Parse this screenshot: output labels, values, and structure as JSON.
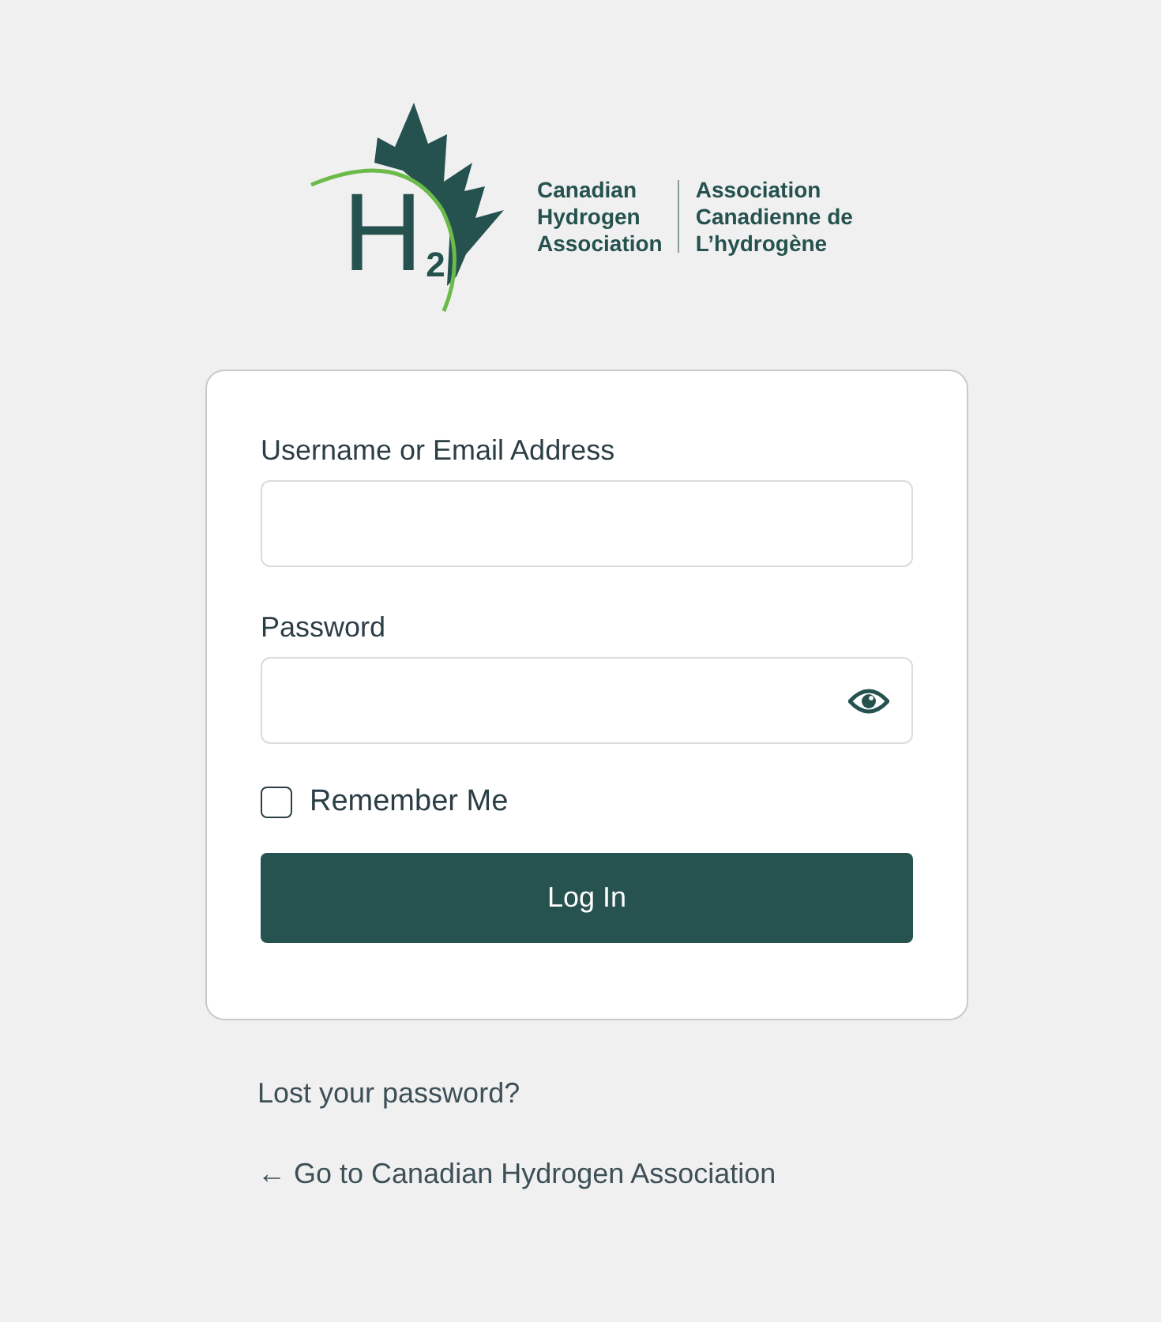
{
  "logo": {
    "mark": "H",
    "mark_sub": "2",
    "name_en": [
      "Canadian",
      "Hydrogen",
      "Association"
    ],
    "name_fr": [
      "Association",
      "Canadienne de",
      "L’hydrogène"
    ]
  },
  "form": {
    "username_label": "Username or Email Address",
    "password_label": "Password",
    "password_visible": false,
    "remember": {
      "label": "Remember Me",
      "checked": false
    },
    "submit": "Log In"
  },
  "links": [
    "Lost your password?",
    "← Go to Canadian Hydrogen Association"
  ]
}
